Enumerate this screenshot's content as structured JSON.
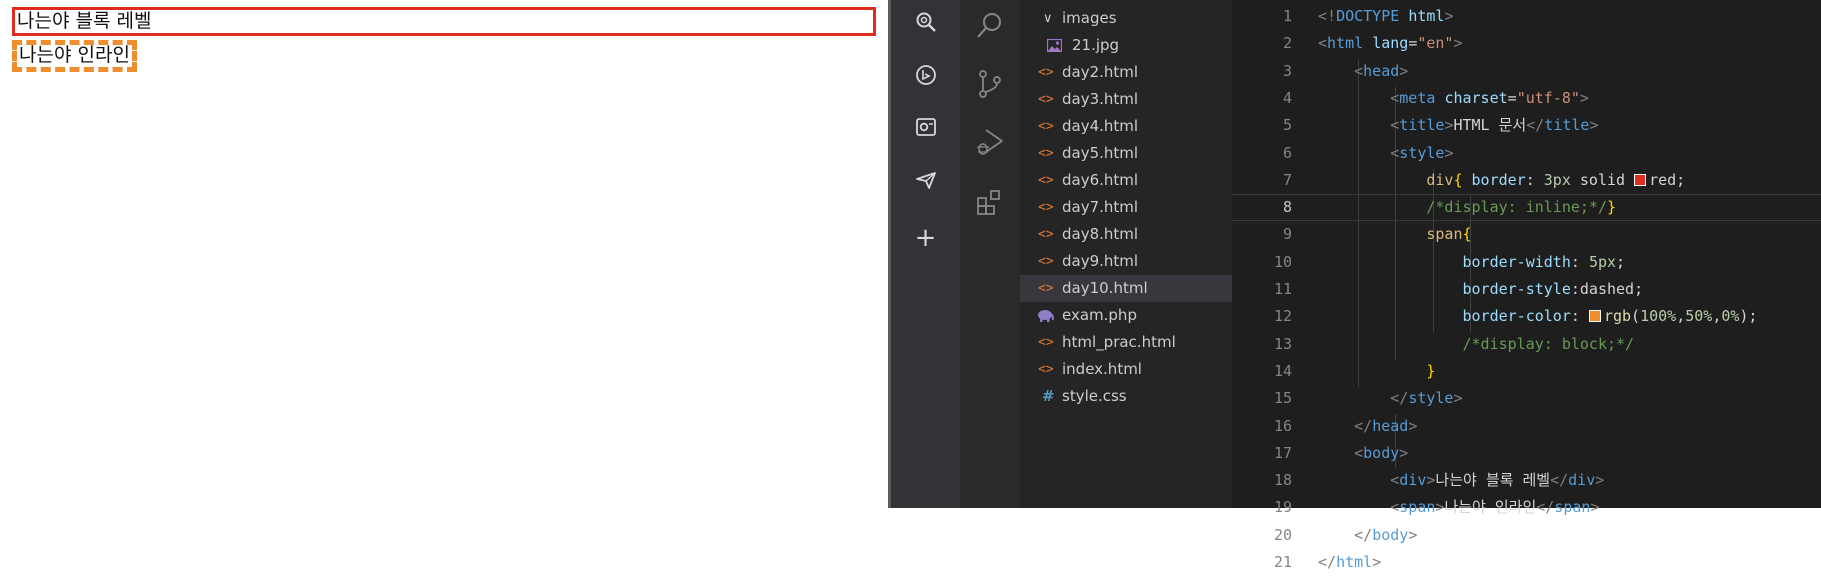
{
  "preview": {
    "div_text": "나는야 블록 레벨",
    "span_text": "나는야 인라인",
    "colors": {
      "div_border": "#e02c1f",
      "span_border": "#ef8e2f"
    }
  },
  "sidebar": {
    "icons": [
      "search-globe-icon",
      "bing-icon",
      "outlook-icon",
      "send-icon",
      "plus-icon"
    ],
    "add_label": "+"
  },
  "activity_bar": {
    "icons": [
      "search-icon",
      "source-control-icon",
      "run-debug-icon",
      "extensions-icon"
    ]
  },
  "explorer": {
    "items": [
      {
        "label": "images",
        "kind": "folder",
        "icon": "chevron-down-icon",
        "glyph": "∨"
      },
      {
        "label": "21.jpg",
        "kind": "image",
        "icon": "image-file-icon"
      },
      {
        "label": "day2.html",
        "kind": "html",
        "icon": "html-file-icon",
        "glyph": "<>"
      },
      {
        "label": "day3.html",
        "kind": "html",
        "icon": "html-file-icon",
        "glyph": "<>"
      },
      {
        "label": "day4.html",
        "kind": "html",
        "icon": "html-file-icon",
        "glyph": "<>"
      },
      {
        "label": "day5.html",
        "kind": "html",
        "icon": "html-file-icon",
        "glyph": "<>"
      },
      {
        "label": "day6.html",
        "kind": "html",
        "icon": "html-file-icon",
        "glyph": "<>"
      },
      {
        "label": "day7.html",
        "kind": "html",
        "icon": "html-file-icon",
        "glyph": "<>"
      },
      {
        "label": "day8.html",
        "kind": "html",
        "icon": "html-file-icon",
        "glyph": "<>"
      },
      {
        "label": "day9.html",
        "kind": "html",
        "icon": "html-file-icon",
        "glyph": "<>"
      },
      {
        "label": "day10.html",
        "kind": "html",
        "icon": "html-file-icon",
        "glyph": "<>",
        "active": true
      },
      {
        "label": "exam.php",
        "kind": "php",
        "icon": "php-elephant-icon"
      },
      {
        "label": "html_prac.html",
        "kind": "html",
        "icon": "html-file-icon",
        "glyph": "<>"
      },
      {
        "label": "index.html",
        "kind": "html",
        "icon": "html-file-icon",
        "glyph": "<>"
      },
      {
        "label": "style.css",
        "kind": "css",
        "icon": "css-file-icon",
        "glyph": "#"
      }
    ]
  },
  "editor": {
    "current_line": 8,
    "lines": [
      {
        "n": "1",
        "t": [
          [
            "tk-br",
            "<!"
          ],
          [
            "tk-tag",
            "DOCTYPE"
          ],
          [
            "tk-txt",
            " "
          ],
          [
            "tk-attr",
            "html"
          ],
          [
            "tk-br",
            ">"
          ]
        ]
      },
      {
        "n": "2",
        "t": [
          [
            "tk-br",
            "<"
          ],
          [
            "tk-tag",
            "html"
          ],
          [
            "tk-txt",
            " "
          ],
          [
            "tk-attr",
            "lang"
          ],
          [
            "tk-txt",
            "="
          ],
          [
            "tk-str",
            "\"en\""
          ],
          [
            "tk-br",
            ">"
          ]
        ]
      },
      {
        "n": "3",
        "t": [
          [
            "tk-txt",
            "    "
          ],
          [
            "tk-br",
            "<"
          ],
          [
            "tk-tag",
            "head"
          ],
          [
            "tk-br",
            ">"
          ]
        ]
      },
      {
        "n": "4",
        "t": [
          [
            "tk-txt",
            "        "
          ],
          [
            "tk-br",
            "<"
          ],
          [
            "tk-tag",
            "meta"
          ],
          [
            "tk-txt",
            " "
          ],
          [
            "tk-attr",
            "charset"
          ],
          [
            "tk-txt",
            "="
          ],
          [
            "tk-str",
            "\"utf-8\""
          ],
          [
            "tk-br",
            ">"
          ]
        ]
      },
      {
        "n": "5",
        "t": [
          [
            "tk-txt",
            "        "
          ],
          [
            "tk-br",
            "<"
          ],
          [
            "tk-tag",
            "title"
          ],
          [
            "tk-br",
            ">"
          ],
          [
            "tk-txt",
            "HTML 문서"
          ],
          [
            "tk-br",
            "</"
          ],
          [
            "tk-tag",
            "title"
          ],
          [
            "tk-br",
            ">"
          ]
        ]
      },
      {
        "n": "6",
        "t": [
          [
            "tk-txt",
            "        "
          ],
          [
            "tk-br",
            "<"
          ],
          [
            "tk-tag",
            "style"
          ],
          [
            "tk-br",
            ">"
          ]
        ]
      },
      {
        "n": "7",
        "t": [
          [
            "tk-txt",
            "            "
          ],
          [
            "tk-sel",
            "div"
          ],
          [
            "tk-brace",
            "{"
          ],
          [
            "tk-txt",
            " "
          ],
          [
            "tk-prop",
            "border"
          ],
          [
            "tk-txt",
            ": "
          ],
          [
            "tk-num",
            "3px"
          ],
          [
            "tk-txt",
            " solid "
          ],
          [
            "swatch",
            "#e02c1f"
          ],
          [
            "tk-txt",
            "red;"
          ]
        ]
      },
      {
        "n": "8",
        "t": [
          [
            "tk-txt",
            "            "
          ],
          [
            "tk-com",
            "/*display: inline;*/"
          ],
          [
            "tk-brace",
            "}"
          ]
        ]
      },
      {
        "n": "9",
        "t": [
          [
            "tk-txt",
            "            "
          ],
          [
            "tk-sel",
            "span"
          ],
          [
            "tk-brace",
            "{"
          ]
        ]
      },
      {
        "n": "10",
        "t": [
          [
            "tk-txt",
            "                "
          ],
          [
            "tk-prop",
            "border-width"
          ],
          [
            "tk-txt",
            ": "
          ],
          [
            "tk-num",
            "5px"
          ],
          [
            "tk-txt",
            ";"
          ]
        ]
      },
      {
        "n": "11",
        "t": [
          [
            "tk-txt",
            "                "
          ],
          [
            "tk-prop",
            "border-style"
          ],
          [
            "tk-txt",
            ":dashed;"
          ]
        ]
      },
      {
        "n": "12",
        "t": [
          [
            "tk-txt",
            "                "
          ],
          [
            "tk-prop",
            "border-color"
          ],
          [
            "tk-txt",
            ": "
          ],
          [
            "swatch",
            "#ef8e2f"
          ],
          [
            "tk-fn",
            "rgb"
          ],
          [
            "tk-txt",
            "("
          ],
          [
            "tk-num",
            "100%"
          ],
          [
            "tk-txt",
            ","
          ],
          [
            "tk-num",
            "50%"
          ],
          [
            "tk-txt",
            ","
          ],
          [
            "tk-num",
            "0%"
          ],
          [
            "tk-txt",
            ");"
          ]
        ]
      },
      {
        "n": "13",
        "t": [
          [
            "tk-txt",
            "                "
          ],
          [
            "tk-com",
            "/*display: block;*/"
          ]
        ]
      },
      {
        "n": "14",
        "t": [
          [
            "tk-txt",
            "            "
          ],
          [
            "tk-brace",
            "}"
          ]
        ]
      },
      {
        "n": "15",
        "t": [
          [
            "tk-txt",
            "        "
          ],
          [
            "tk-br",
            "</"
          ],
          [
            "tk-tag",
            "style"
          ],
          [
            "tk-br",
            ">"
          ]
        ]
      },
      {
        "n": "16",
        "t": [
          [
            "tk-txt",
            "    "
          ],
          [
            "tk-br",
            "</"
          ],
          [
            "tk-tag",
            "head"
          ],
          [
            "tk-br",
            ">"
          ]
        ]
      },
      {
        "n": "17",
        "t": [
          [
            "tk-txt",
            "    "
          ],
          [
            "tk-br",
            "<"
          ],
          [
            "tk-tag",
            "body"
          ],
          [
            "tk-br",
            ">"
          ]
        ]
      },
      {
        "n": "18",
        "t": [
          [
            "tk-txt",
            "        "
          ],
          [
            "tk-br",
            "<"
          ],
          [
            "tk-tag",
            "div"
          ],
          [
            "tk-br",
            ">"
          ],
          [
            "tk-txt",
            "나는야 블록 레벨"
          ],
          [
            "tk-br",
            "</"
          ],
          [
            "tk-tag",
            "div"
          ],
          [
            "tk-br",
            ">"
          ]
        ]
      },
      {
        "n": "19",
        "t": [
          [
            "tk-txt",
            "        "
          ],
          [
            "tk-br",
            "<"
          ],
          [
            "tk-tag",
            "span"
          ],
          [
            "tk-br",
            ">"
          ],
          [
            "tk-txt",
            "나는야 인라인"
          ],
          [
            "tk-br",
            "</"
          ],
          [
            "tk-tag",
            "span"
          ],
          [
            "tk-br",
            ">"
          ]
        ]
      },
      {
        "n": "20",
        "t": [
          [
            "tk-txt",
            "    "
          ],
          [
            "tk-br",
            "</"
          ],
          [
            "tk-tag",
            "body"
          ],
          [
            "tk-br",
            ">"
          ]
        ]
      },
      {
        "n": "21",
        "t": [
          [
            "tk-br",
            "</"
          ],
          [
            "tk-tag",
            "html"
          ],
          [
            "tk-br",
            ">"
          ]
        ]
      }
    ]
  }
}
